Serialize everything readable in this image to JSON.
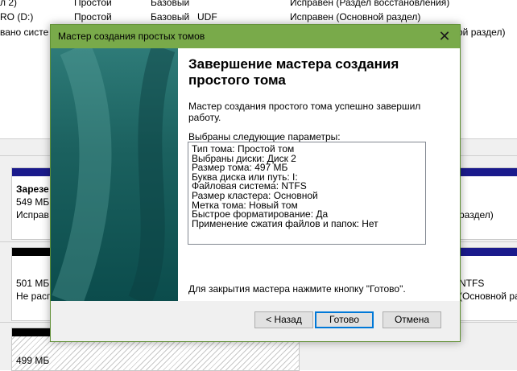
{
  "background": {
    "list_rows": [
      {
        "name": "л 2)",
        "layout": "Простой",
        "type": "Базовый",
        "fs": "",
        "status": "Исправен (Раздел восстановления)"
      },
      {
        "name": "RO (D:)",
        "layout": "Простой",
        "type": "Базовый",
        "fs": "UDF",
        "status": "Исправен (Основной раздел)"
      },
      {
        "name": "вано систе",
        "layout": "",
        "type": "",
        "fs": "",
        "status": "ой раздел)"
      }
    ],
    "disk1": {
      "name": "Зарезе",
      "size": "549 МБ",
      "status": "Исправ",
      "right_status": "раздел)"
    },
    "disk2": {
      "size": "501 МБ",
      "status": "Не расп",
      "right_fs": "NTFS",
      "right_status": "(Основной раздел"
    },
    "disk3": {
      "size": "499 МБ"
    }
  },
  "dialog": {
    "title": "Мастер создания простых томов",
    "heading": "Завершение мастера создания простого тома",
    "success": "Мастер создания простого тома успешно завершил работу.",
    "params_label": "Выбраны следующие параметры:",
    "params": [
      "Тип тома: Простой том",
      "Выбраны диски: Диск 2",
      "Размер тома: 497 МБ",
      "Буква диска или путь: I:",
      "Файловая система: NTFS",
      "Размер кластера: Основной",
      "Метка тома: Новый том",
      "Быстрое форматирование: Да",
      "Применение сжатия файлов и папок: Нет"
    ],
    "footer": "Для закрытия мастера нажмите кнопку \"Готово\".",
    "buttons": {
      "back": "< Назад",
      "finish": "Готово",
      "cancel": "Отмена"
    },
    "close_glyph": "✕"
  },
  "colors": {
    "titlebar": "#79aa4a",
    "side_panel": "#1b615f",
    "primary_border": "#0078d7"
  }
}
